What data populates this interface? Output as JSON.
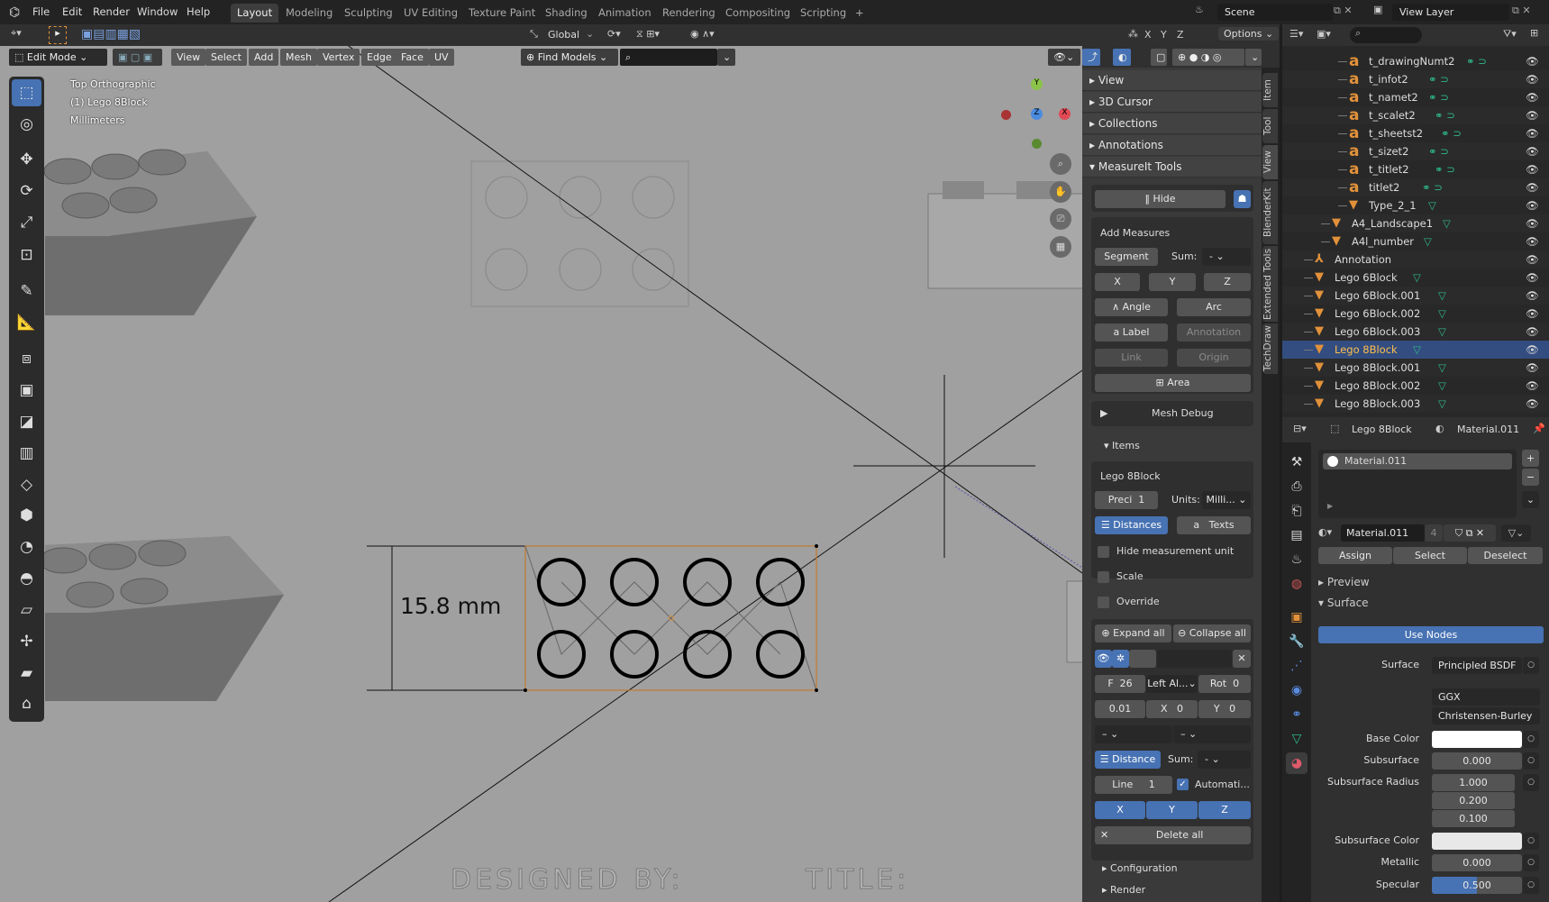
{
  "menu": [
    "File",
    "Edit",
    "Render",
    "Window",
    "Help"
  ],
  "workspaces": [
    "Layout",
    "Modeling",
    "Sculpting",
    "UV Editing",
    "Texture Paint",
    "Shading",
    "Animation",
    "Rendering",
    "Compositing",
    "Scripting",
    "+"
  ],
  "scene": {
    "label": "Scene",
    "view_layer": "View Layer"
  },
  "tool_header": {
    "orientation": "Global",
    "options": "Options",
    "axes": [
      "X",
      "Y",
      "Z"
    ]
  },
  "view_header": {
    "mode": "Edit Mode",
    "menus": [
      "View",
      "Select",
      "Add",
      "Mesh",
      "Vertex",
      "Edge",
      "Face",
      "UV"
    ],
    "find_models": "Find Models"
  },
  "viewport": {
    "view_name": "Top Orthographic",
    "object": "(1) Lego 8Block",
    "units": "Millimeters",
    "measure_label": "15.8 mm",
    "bottom_text": "DESIGNED BY:          TITLE:",
    "gizmo": {
      "x": "X",
      "y": "Y",
      "z": "Z"
    }
  },
  "npanel": {
    "sections": [
      "View",
      "3D Cursor",
      "Collections",
      "Annotations",
      "MeasureIt Tools"
    ],
    "hide": "Hide",
    "add_measures": "Add Measures",
    "segment": "Segment",
    "sum": "Sum:",
    "sum_value": "-",
    "x": "X",
    "y": "Y",
    "z": "Z",
    "angle": "Angle",
    "arc": "Arc",
    "label": "Label",
    "annotation": "Annotation",
    "link": "Link",
    "origin": "Origin",
    "area": "Area",
    "mesh_debug": "Mesh Debug",
    "items": "Items",
    "object": "Lego 8Block",
    "preci": "Preci",
    "preci_value": "1",
    "units": "Units:",
    "units_value": "Milli...",
    "distances": "Distances",
    "texts": "Texts",
    "hide_unit": "Hide measurement unit",
    "scale": "Scale",
    "override": "Override",
    "expand_all": "Expand all",
    "collapse_all": "Collapse all",
    "f_label": "F",
    "f_value": "26",
    "align": "Left Al...",
    "rot": "Rot",
    "rot_value": "0",
    "offset": "0.01",
    "ox": "X",
    "ox_value": "0",
    "oy": "Y",
    "oy_value": "0",
    "dash": "–",
    "distance": "Distance",
    "sum2": "Sum:",
    "sum2_value": "-",
    "line": "Line",
    "line_value": "1",
    "automatic": "Automati...",
    "automatic_checked": true,
    "delete_all": "Delete all",
    "configuration": "Configuration",
    "render": "Render",
    "tabs": [
      "Item",
      "Tool",
      "View",
      "BlenderKit",
      "Extended Tools",
      "TechDraw"
    ],
    "active_tab": "View"
  },
  "outliner": {
    "rows": [
      {
        "name": "t_drawingNumt2",
        "icon": "text",
        "level": 3
      },
      {
        "name": "t_infot2",
        "icon": "text",
        "level": 3
      },
      {
        "name": "t_namet2",
        "icon": "text",
        "level": 3
      },
      {
        "name": "t_scalet2",
        "icon": "text",
        "level": 3
      },
      {
        "name": "t_sheetst2",
        "icon": "text",
        "level": 3
      },
      {
        "name": "t_sizet2",
        "icon": "text",
        "level": 3
      },
      {
        "name": "t_titlet2",
        "icon": "text",
        "level": 3
      },
      {
        "name": "titlet2",
        "icon": "text",
        "level": 3
      },
      {
        "name": "Type_2_1",
        "icon": "mesh",
        "level": 3
      },
      {
        "name": "A4_Landscape1",
        "icon": "mesh",
        "level": 2
      },
      {
        "name": "A4l_number",
        "icon": "mesh",
        "level": 2
      },
      {
        "name": "Annotation",
        "icon": "annotation",
        "level": 1
      },
      {
        "name": "Lego 6Block",
        "icon": "mesh",
        "level": 1
      },
      {
        "name": "Lego 6Block.001",
        "icon": "mesh",
        "level": 1
      },
      {
        "name": "Lego 6Block.002",
        "icon": "mesh",
        "level": 1
      },
      {
        "name": "Lego 6Block.003",
        "icon": "mesh",
        "level": 1
      },
      {
        "name": "Lego 8Block",
        "icon": "mesh",
        "level": 1,
        "selected": true
      },
      {
        "name": "Lego 8Block.001",
        "icon": "mesh",
        "level": 1
      },
      {
        "name": "Lego 8Block.002",
        "icon": "mesh",
        "level": 1
      },
      {
        "name": "Lego 8Block.003",
        "icon": "mesh",
        "level": 1
      }
    ]
  },
  "properties": {
    "object": "Lego 8Block",
    "material": "Material.011",
    "slot": "Material.011",
    "material_users": "4",
    "assign": "Assign",
    "select": "Select",
    "deselect": "Deselect",
    "preview": "Preview",
    "surface_panel": "Surface",
    "use_nodes": "Use Nodes",
    "rows": {
      "surface": "Surface",
      "surface_value": "Principled BSDF",
      "distribution": "GGX",
      "subsurface_method": "Christensen-Burley",
      "base_color": "Base Color",
      "subsurface": "Subsurface",
      "subsurface_value": "0.000",
      "subsurface_radius": "Subsurface Radius",
      "radius": [
        "1.000",
        "0.200",
        "0.100"
      ],
      "subsurface_color": "Subsurface Color",
      "metallic": "Metallic",
      "metallic_value": "0.000",
      "specular": "Specular",
      "specular_value": "0.500"
    },
    "specular_fraction": 0.5,
    "colors": {
      "base_color": "#ffffff",
      "subsurface_color": "#e8e8e8"
    }
  },
  "colors": {
    "accent": "#4772b3",
    "selected_text": "#ffbf4d",
    "object_orange": "#e2913a",
    "data_green": "#2eb88a"
  }
}
